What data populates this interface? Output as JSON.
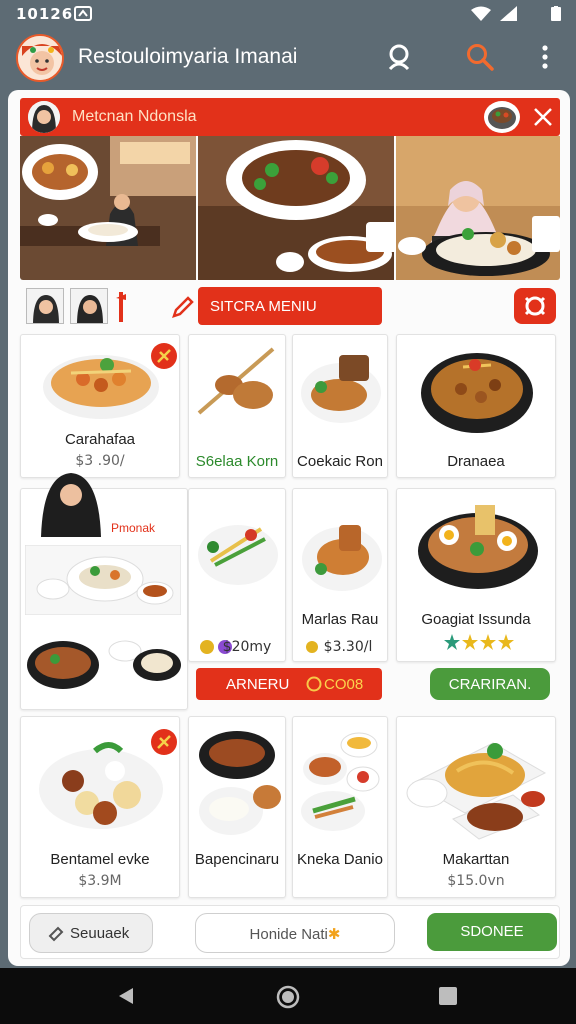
{
  "status_bar": {
    "time": "10126"
  },
  "app_bar": {
    "title": "Restouloimyaria Imanai",
    "search_icon": "search-icon",
    "account_icon": "account-icon",
    "more_icon": "more-vert-icon"
  },
  "banner": {
    "title": "Metcnan Ndonsla"
  },
  "system_menu": {
    "label": "SITCRA MENIU"
  },
  "menu_items": [
    {
      "name": "Carahafaa",
      "price": "$3 .90/"
    },
    {
      "name": "S6elaa Korn",
      "price": ""
    },
    {
      "name": "Coekaic Ron",
      "price": ""
    },
    {
      "name": "Dranaea",
      "price": ""
    }
  ],
  "promo": {
    "label": "Pmonak"
  },
  "row2_items": [
    {
      "name": "",
      "price": "$20my"
    },
    {
      "name": "Marlas Rau",
      "price": "$3.30/l"
    },
    {
      "name": "Goagiat Issunda",
      "price": ""
    }
  ],
  "order_button": {
    "label": "ARNERU",
    "badge": "CO08"
  },
  "caraman_button": {
    "label": "CRARIRAN."
  },
  "row3_items": [
    {
      "name": "Bentamel evke",
      "price": "$3.9M"
    },
    {
      "name": "Bapencinaru",
      "price": ""
    },
    {
      "name": "Kneka Danio",
      "price": ""
    },
    {
      "name": "Makarttan",
      "price": "$15.0vn"
    }
  ],
  "bottom_actions": {
    "left_label": "Seuuaek",
    "center_label": "Honide Nati",
    "right_label": "SDONEE"
  },
  "colors": {
    "accent": "#e2311a",
    "green": "#4b9b3c",
    "appbar": "#5d6b74"
  }
}
